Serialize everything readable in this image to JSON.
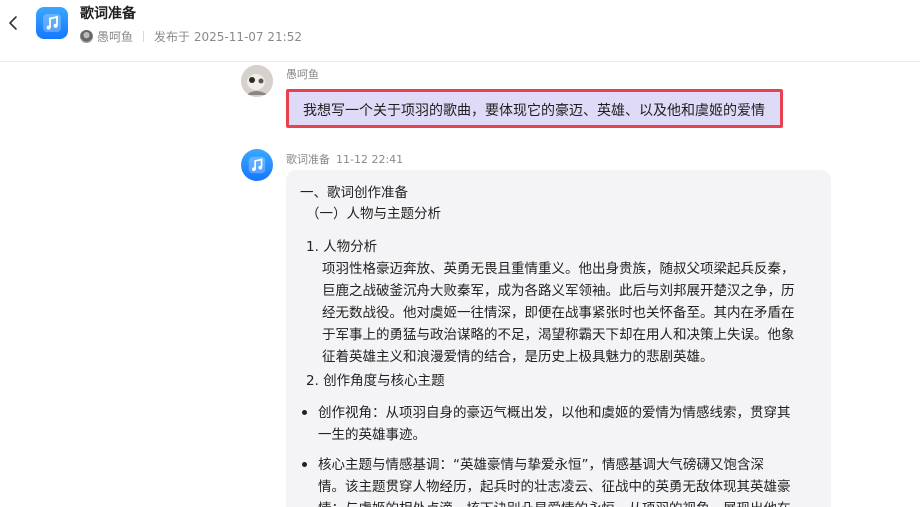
{
  "header": {
    "app_title": "歌词准备",
    "author": "愚呵鱼",
    "published": "发布于 2025-11-07 21:52"
  },
  "user_message": {
    "name": "愚呵鱼",
    "text": "我想写一个关于项羽的歌曲，要体现它的豪迈、英雄、以及他和虞姬的爱情"
  },
  "bot_message": {
    "name": "歌词准备",
    "time": "11-12 22:41",
    "lines": [
      "一、歌词创作准备",
      "（一）人物与主题分析",
      "1. 人物分析",
      "项羽性格豪迈奔放、英勇无畏且重情重义。他出身贵族，随叔父项梁起兵反秦，",
      "巨鹿之战破釜沉舟大败秦军，成为各路义军领袖。此后与刘邦展开楚汉之争，历",
      "经无数战役。他对虞姬一往情深，即便在战事紧张时也关怀备至。其内在矛盾在",
      "于军事上的勇猛与政治谋略的不足，渴望称霸天下却在用人和决策上失误。他象",
      "征着英雄主义和浪漫爱情的结合，是历史上极具魅力的悲剧英雄。",
      "2. 创作角度与核心主题",
      "创作视角：从项羽自身的豪迈气概出发，以他和虞姬的爱情为情感线索，贯穿其",
      "一生的英雄事迹。",
      "核心主题与情感基调：“英雄豪情与挚爱永恒”，情感基调大气磅礴又饱含深",
      "情。该主题贯穿人物经历，起兵时的壮志凌云、征战中的英勇无敌体现其英雄豪",
      "情；与虞姬的相处点滴，垓下诀别凸显爱情的永恒。从项羽的视角，展现出他在"
    ]
  }
}
